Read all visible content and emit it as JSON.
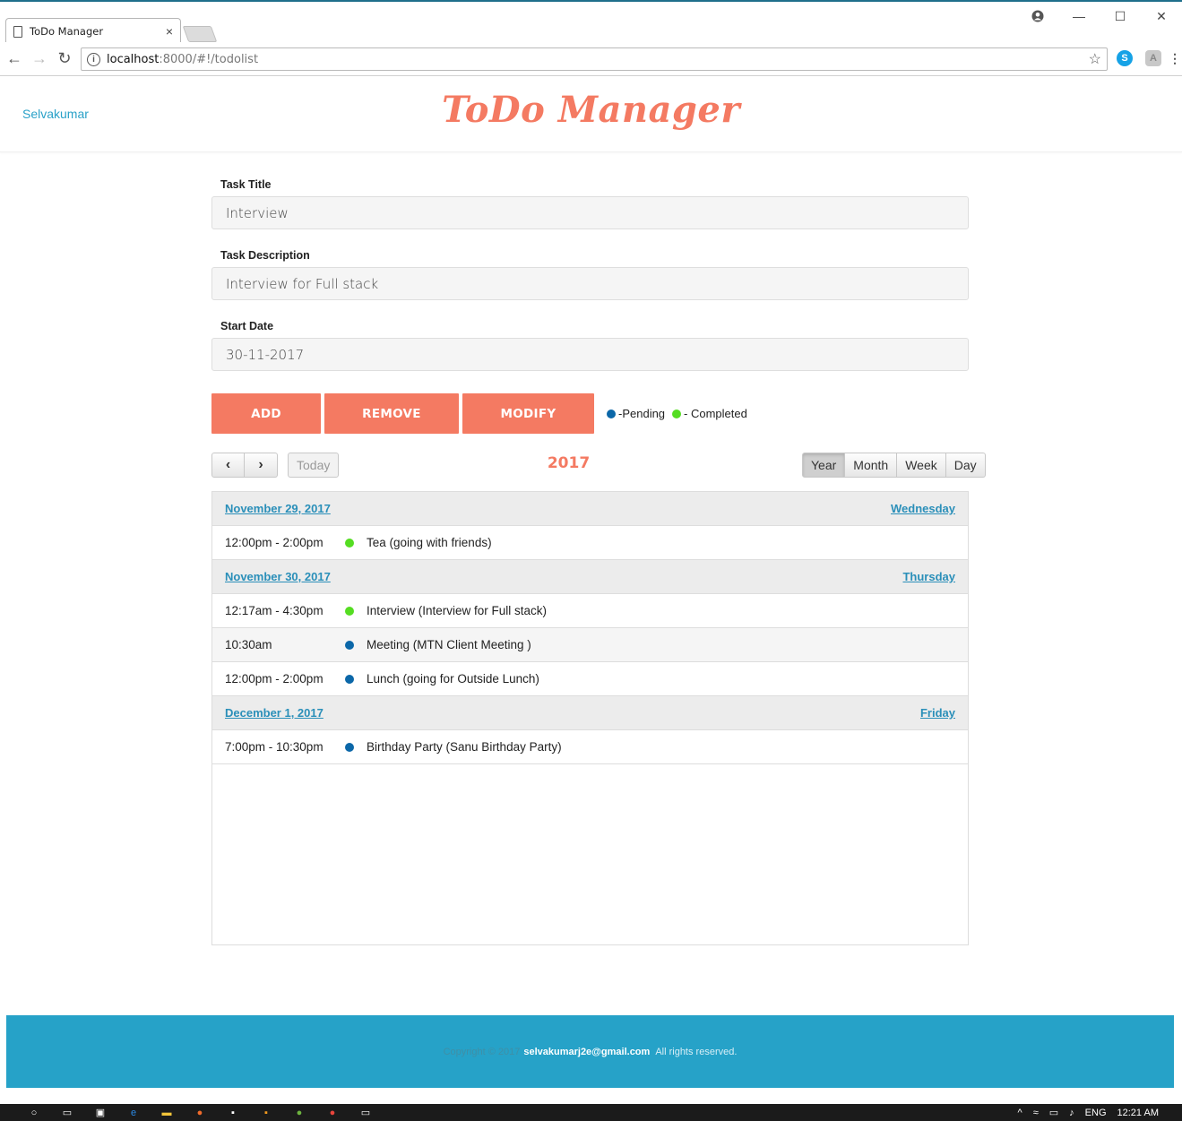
{
  "browser": {
    "tab_title": "ToDo Manager",
    "tab_close": "×",
    "url_host": "localhost",
    "url_path": ":8000/#!/todolist",
    "window_controls": [
      "—",
      "☐",
      "✕"
    ]
  },
  "header": {
    "user_name": "Selvakumar",
    "brand": "ToDo Manager"
  },
  "form": {
    "title_label": "Task Title",
    "title_value": "Interview",
    "description_label": "Task Description",
    "description_value": "Interview for Full stack",
    "start_date_label": "Start Date",
    "start_date_value": "30-11-2017"
  },
  "actions": {
    "add": "ADD",
    "remove": "REMOVE",
    "modify": "MODIFY"
  },
  "legend": {
    "pending": "-Pending",
    "completed": "- Completed",
    "pending_color": "#0b67a8",
    "completed_color": "#55dd22"
  },
  "calendar": {
    "prev": "‹",
    "next": "›",
    "today": "Today",
    "title": "2017",
    "views": [
      "Year",
      "Month",
      "Week",
      "Day"
    ],
    "active_view": "Year",
    "days": [
      {
        "date": "November 29, 2017",
        "weekday": "Wednesday",
        "events": [
          {
            "time": "12:00pm - 2:00pm",
            "title": "Tea (going with friends)",
            "status": "completed"
          }
        ]
      },
      {
        "date": "November 30, 2017",
        "weekday": "Thursday",
        "events": [
          {
            "time": "12:17am - 4:30pm",
            "title": "Interview (Interview for Full stack)",
            "status": "completed"
          },
          {
            "time": "10:30am",
            "title": "Meeting (MTN Client Meeting )",
            "status": "pending"
          },
          {
            "time": "12:00pm - 2:00pm",
            "title": "Lunch (going for Outside Lunch)",
            "status": "pending"
          }
        ]
      },
      {
        "date": "December 1, 2017",
        "weekday": "Friday",
        "events": [
          {
            "time": "7:00pm - 10:30pm",
            "title": "Birthday Party (Sanu Birthday Party)",
            "status": "pending"
          }
        ]
      }
    ]
  },
  "footer": {
    "copyright": "Copyright © 2017",
    "email": "selvakumarj2e@gmail.com",
    "rights": "All rights reserved."
  },
  "taskbar": {
    "language": "ENG",
    "time": "12:21 AM"
  }
}
